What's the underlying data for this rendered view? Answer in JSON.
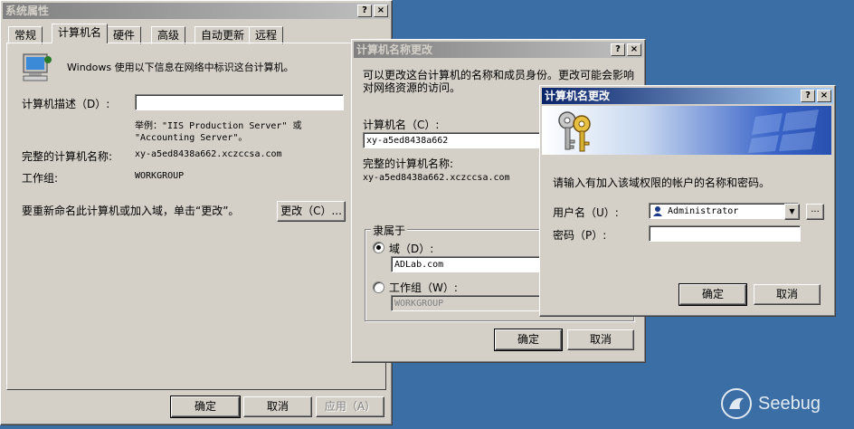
{
  "sysprops": {
    "title": "系统属性",
    "tabs": [
      "常规",
      "计算机名",
      "硬件",
      "高级",
      "自动更新",
      "远程"
    ],
    "intro": "Windows 使用以下信息在网络中标识这台计算机。",
    "desc_label": "计算机描述（D）:",
    "desc_value": "",
    "example": "举例：\"IIS Production Server\" 或",
    "example2": "\"Accounting Server\"。",
    "fullname_label": "完整的计算机名称:",
    "fullname_value": "xy-a5ed8438a662.xczccsa.com",
    "workgroup_label": "工作组:",
    "workgroup_value": "WORKGROUP",
    "rename_text": "要重新命名此计算机或加入域，单击“更改”。",
    "change_btn": "更改（C）...",
    "ok": "确定",
    "cancel": "取消",
    "apply": "应用（A）"
  },
  "namechange": {
    "title": "计算机名称更改",
    "intro1": "可以更改这台计算机的名称和成员身份。更改可能会影响",
    "intro2": "对网络资源的访问。",
    "name_label": "计算机名（C）:",
    "name_value": "xy-a5ed8438a662",
    "fullname_label": "完整的计算机名称:",
    "fullname_value": "xy-a5ed8438a662.xczccsa.com",
    "member_label": "隶属于",
    "domain_label": "域（D）:",
    "domain_value": "ADLab.com",
    "workgroup_label": "工作组（W）:",
    "workgroup_value": "WORKGROUP",
    "ok": "确定",
    "cancel": "取消"
  },
  "cred": {
    "title": "计算机名更改",
    "prompt": "请输入有加入该域权限的帐户的名称和密码。",
    "user_label": "用户名（U）:",
    "user_value": "Administrator",
    "pass_label": "密码（P）:",
    "pass_value": "",
    "browse": "...",
    "ok": "确定",
    "cancel": "取消"
  },
  "watermark": "Seebug",
  "title_buttons": {
    "help": "?",
    "close": "×"
  }
}
